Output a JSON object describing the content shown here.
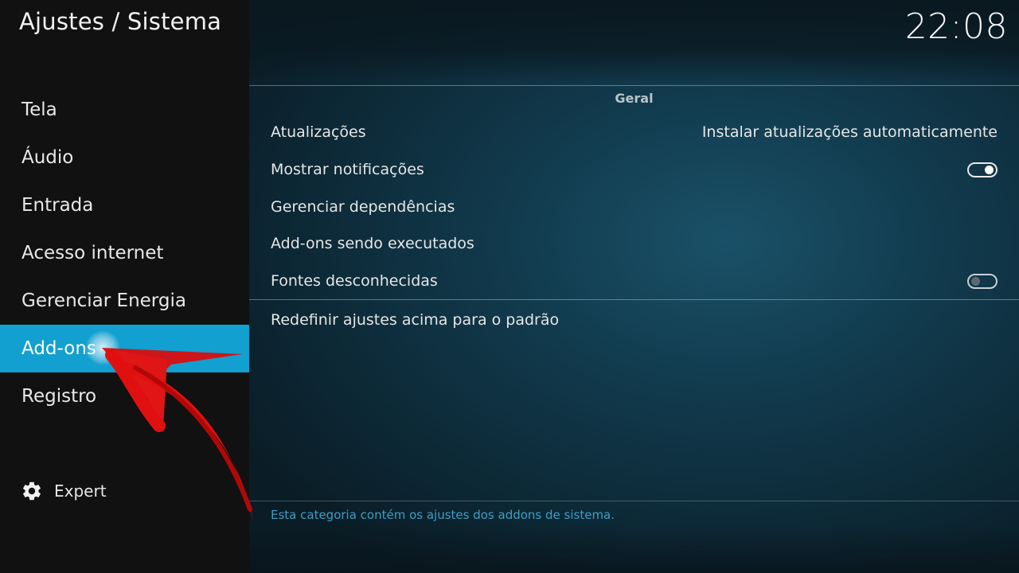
{
  "header": {
    "title": "Ajustes / Sistema",
    "clock": "22:08"
  },
  "sidebar": {
    "items": [
      {
        "label": "Tela",
        "active": false
      },
      {
        "label": "Áudio",
        "active": false
      },
      {
        "label": "Entrada",
        "active": false
      },
      {
        "label": "Acesso internet",
        "active": false
      },
      {
        "label": "Gerenciar Energia",
        "active": false
      },
      {
        "label": "Add-ons",
        "active": true
      },
      {
        "label": "Registro",
        "active": false
      }
    ],
    "expert": {
      "label": "Expert",
      "icon": "gear-icon"
    }
  },
  "main": {
    "section_title": "Geral",
    "settings": [
      {
        "label": "Atualizações",
        "value": "Instalar atualizações automaticamente"
      },
      {
        "label": "Mostrar notificações",
        "toggle": true
      },
      {
        "label": "Gerenciar dependências"
      },
      {
        "label": "Add-ons sendo executados"
      },
      {
        "label": "Fontes desconhecidas",
        "toggle": false
      }
    ],
    "reset_label": "Redefinir ajustes acima para o padrão",
    "description": "Esta categoria contém os ajustes dos addons de sistema."
  },
  "colors": {
    "accent": "#12a0d0",
    "sidebar_bg": "#111111",
    "annotation_arrow": "#e01010",
    "description_text": "#3e9ec4"
  }
}
